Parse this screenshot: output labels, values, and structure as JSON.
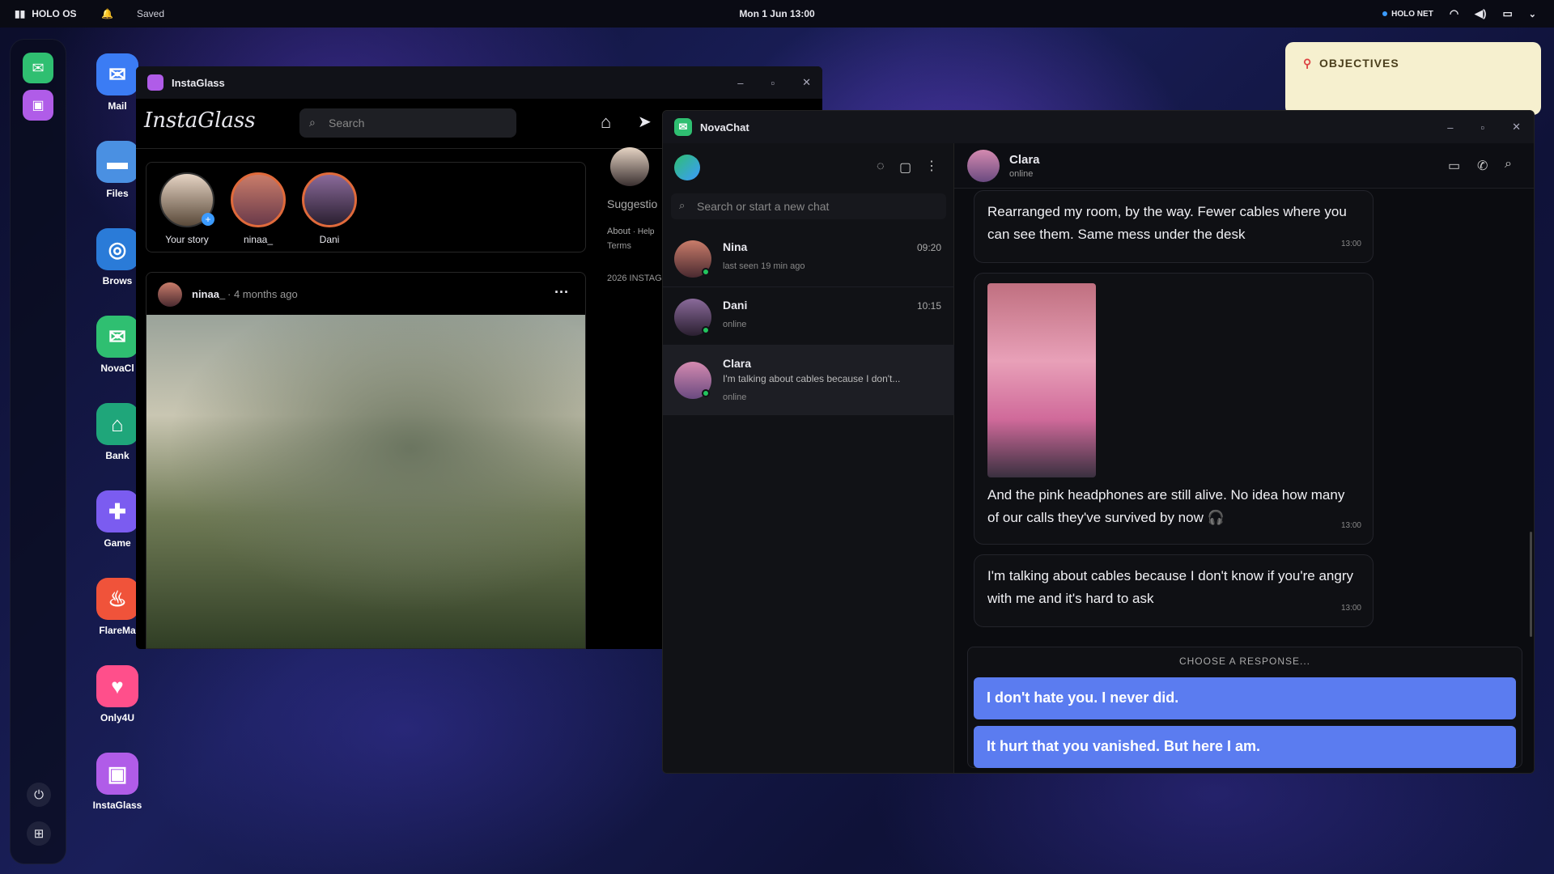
{
  "topbar": {
    "os_name": "HOLO OS",
    "status": "Saved",
    "clock": "Mon 1 Jun 13:00",
    "network": "HOLO NET"
  },
  "desktop_icons": [
    {
      "label": "Mail",
      "color": "#3b7cf4",
      "glyph": "✉"
    },
    {
      "label": "Files",
      "color": "#4a90e2",
      "glyph": "▬"
    },
    {
      "label": "Brows",
      "color": "#2a7bd8",
      "glyph": "◎"
    },
    {
      "label": "NovaCl",
      "color": "#2fbf71",
      "glyph": "✉"
    },
    {
      "label": "Bank",
      "color": "#1fa67a",
      "glyph": "⌂"
    },
    {
      "label": "Game",
      "color": "#7b5cf0",
      "glyph": "✚"
    },
    {
      "label": "FlareMa",
      "color": "#f0533a",
      "glyph": "♨"
    },
    {
      "label": "Only4U",
      "color": "#ff4f8b",
      "glyph": "♥"
    },
    {
      "label": "InstaGlass",
      "color": "#b05ce8",
      "glyph": "▣"
    }
  ],
  "objectives": {
    "title": "OBJECTIVES"
  },
  "instaglass": {
    "title": "InstaGlass",
    "logo": "InstaGlass",
    "search_placeholder": "Search",
    "stories": [
      {
        "label": "Your story"
      },
      {
        "label": "ninaa_"
      },
      {
        "label": "Dani"
      }
    ],
    "post": {
      "user": "ninaa_",
      "time": "· 4 months ago"
    },
    "sidebar": {
      "suggestions": "Suggestio",
      "about": "About",
      "help": "· Help",
      "terms": "Terms",
      "copyright": "2026 INSTAG"
    }
  },
  "novachat": {
    "title": "NovaChat",
    "search_placeholder": "Search or start a new chat",
    "chats": [
      {
        "name": "Nina",
        "time": "09:20",
        "status": "last seen 19 min ago"
      },
      {
        "name": "Dani",
        "time": "10:15",
        "status": "online"
      },
      {
        "name": "Clara",
        "preview": "I'm talking about cables because I don't...",
        "status": "online"
      }
    ],
    "conversation": {
      "name": "Clara",
      "status": "online",
      "messages": [
        {
          "text": "Rearranged my room, by the way. Fewer cables where you can see them. Same mess under the desk",
          "time": "13:00"
        },
        {
          "text": "And the pink headphones are still alive. No idea how many of our calls they've survived by now 🎧",
          "time": "13:00"
        },
        {
          "text": "I'm talking about cables because I don't know if you're angry with me and it's hard to ask",
          "time": "13:00"
        }
      ],
      "choose_label": "CHOOSE A RESPONSE...",
      "choices": [
        "I don't hate you. I never did.",
        "It hurt that you vanished. But here I am."
      ]
    }
  },
  "colors": {
    "accent": "#5b7cf0",
    "online": "#22c55e",
    "objectives_bg": "#f6f0cf"
  }
}
